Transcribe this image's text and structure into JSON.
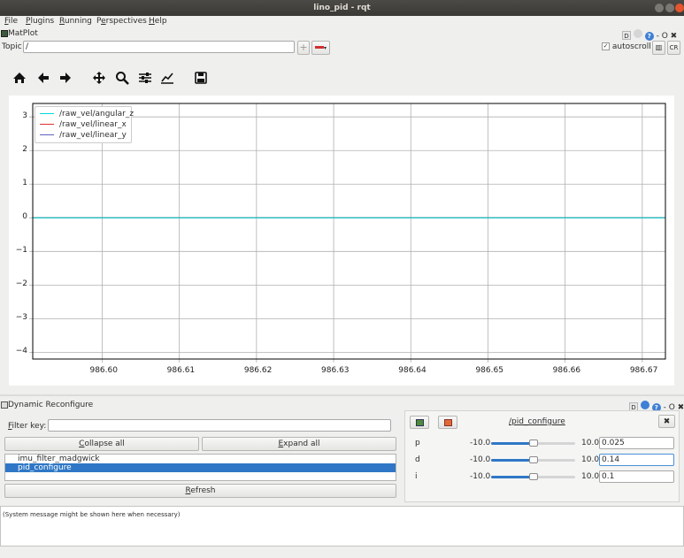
{
  "window": {
    "title": "lino_pid - rqt"
  },
  "menu": {
    "file": "File",
    "plugins": "Plugins",
    "running": "Running",
    "perspectives": "Perspectives",
    "help": "Help"
  },
  "matplot": {
    "title": "MatPlot",
    "topic_label": "Topic",
    "topic_value": "/",
    "autoscroll_label": "autoscroll",
    "autoscroll_checked": true
  },
  "plugin_controls": {
    "d_label": "D",
    "close": "- O ✖"
  },
  "chart_data": {
    "type": "line",
    "x_ticks": [
      "986.60",
      "986.61",
      "986.62",
      "986.63",
      "986.64",
      "986.65",
      "986.66",
      "986.67"
    ],
    "x_tick_values": [
      986.6,
      986.61,
      986.62,
      986.63,
      986.64,
      986.65,
      986.66,
      986.67
    ],
    "y_ticks": [
      "3",
      "2",
      "1",
      "0",
      "−1",
      "−2",
      "−3",
      "−4"
    ],
    "y_tick_values": [
      3,
      2,
      1,
      0,
      -1,
      -2,
      -3,
      -4
    ],
    "xlim": [
      986.591,
      986.673
    ],
    "ylim": [
      -4.2,
      3.4
    ],
    "grid": true,
    "legend_position": "top-left",
    "series": [
      {
        "name": "/raw_vel/angular_z",
        "color": "#00d8d8",
        "x": [
          986.591,
          986.673
        ],
        "y": [
          0,
          0
        ]
      },
      {
        "name": "/raw_vel/linear_x",
        "color": "#e03030",
        "x": [
          986.591,
          986.673
        ],
        "y": [
          0,
          0
        ]
      },
      {
        "name": "/raw_vel/linear_y",
        "color": "#6060c0",
        "x": [
          986.591,
          986.673
        ],
        "y": [
          0,
          0
        ]
      }
    ]
  },
  "dynreconf": {
    "title": "Dynamic Reconfigure",
    "filter_label": "Filter key:",
    "filter_value": "",
    "collapse_all": "Collapse all",
    "expand_all": "Expand all",
    "refresh": "Refresh",
    "nodes": [
      {
        "label": "imu_filter_madgwick",
        "selected": false
      },
      {
        "label": "pid_configure",
        "selected": true
      }
    ],
    "node_title": "/pid_configure",
    "close_glyph": "✖",
    "params": [
      {
        "name": "p",
        "min": "-10.0",
        "max": "10.0",
        "value": "0.025",
        "fraction": 0.501
      },
      {
        "name": "d",
        "min": "-10.0",
        "max": "10.0",
        "value": "0.14",
        "fraction": 0.507
      },
      {
        "name": "i",
        "min": "-10.0",
        "max": "10.0",
        "value": "0.1",
        "fraction": 0.505
      }
    ]
  },
  "status": {
    "message": "(System message might be shown here when necessary)"
  },
  "colors": {
    "accent": "#2f77c6",
    "titlebar": "#3c3b37",
    "close": "#e4542d"
  }
}
